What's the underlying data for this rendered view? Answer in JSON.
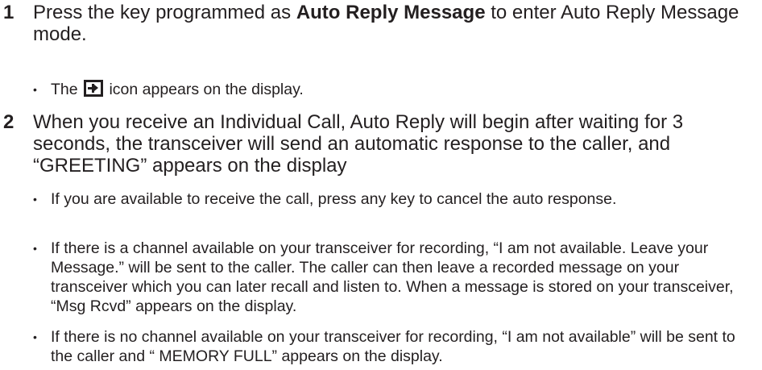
{
  "steps": [
    {
      "number": "1",
      "text_before": "Press the key programmed as ",
      "text_bold": "Auto Reply Message",
      "text_after": " to enter Auto Reply Message mode.",
      "bullets": [
        {
          "before": "The ",
          "icon": "auto-reply-icon",
          "after": " icon appears on the display."
        }
      ]
    },
    {
      "number": "2",
      "text": "When you receive an Individual Call, Auto Reply will begin after waiting for 3 seconds, the transceiver will send an automatic response to the caller, and “GREETING” appears on the display",
      "bullets": [
        {
          "text": "If you are available to receive the call, press any key to cancel the auto response."
        },
        {
          "text": "If there is a channel available on your transceiver for recording, “I am not available. Leave your Message.” will be sent to the caller.  The caller can then leave a recorded message on your transceiver which you can later recall and listen to.  When a message is stored on your transceiver, “Msg Rcvd” appears on the display."
        },
        {
          "text": "If there is no channel available on your transceiver for recording, “I am not available” will be sent to the caller and “ MEMORY FULL” appears on the display."
        }
      ]
    }
  ],
  "bullet_glyph": "•"
}
